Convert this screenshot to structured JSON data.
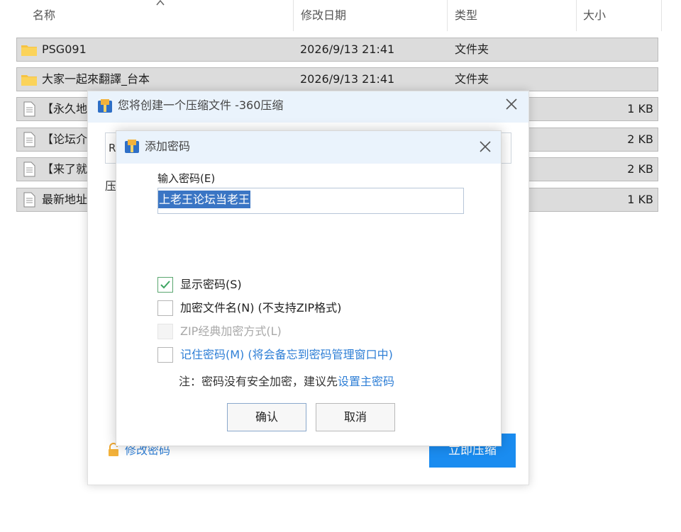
{
  "explorer": {
    "columns": {
      "name": "名称",
      "modified": "修改日期",
      "type": "类型",
      "size": "大小"
    },
    "rows": [
      {
        "name": "PSG091",
        "modified": "2026/9/13 21:41",
        "type": "文件夹",
        "size": "",
        "kind": "folder"
      },
      {
        "name": "大家一起來翻譯_台本",
        "modified": "2026/9/13 21:41",
        "type": "文件夹",
        "size": "",
        "kind": "folder"
      },
      {
        "name": "【永久地",
        "modified": "",
        "type": "",
        "size": "1 KB",
        "kind": "file"
      },
      {
        "name": "【论坛介",
        "modified": "",
        "type": "",
        "size": "2 KB",
        "kind": "file"
      },
      {
        "name": "【来了就",
        "modified": "",
        "type": "",
        "size": "2 KB",
        "kind": "file"
      },
      {
        "name": "最新地址",
        "modified": "",
        "type": "",
        "size": "1 KB",
        "kind": "file"
      }
    ]
  },
  "compress_dialog": {
    "title": "您将创建一个压缩文件 -360压缩",
    "path_prefix": "R",
    "compress_label_partial": "压",
    "modify_password": "修改密码",
    "compress_now": "立即压缩"
  },
  "password_dialog": {
    "title": "添加密码",
    "input_label": "输入密码(E)",
    "password_value": "上老王论坛当老王",
    "options": [
      {
        "label": "显示密码(S)",
        "checked": true,
        "disabled": false
      },
      {
        "label": "加密文件名(N) (不支持ZIP格式)",
        "checked": false,
        "disabled": false
      },
      {
        "label": "ZIP经典加密方式(L)",
        "checked": false,
        "disabled": true
      },
      {
        "label": "记住密码(M) (将会备忘到密码管理窗口中)",
        "checked": false,
        "disabled": false
      }
    ],
    "note_prefix": "注：密码没有安全加密，建议先",
    "note_link": "设置主密码",
    "ok": "确认",
    "cancel": "取消"
  },
  "colors": {
    "accent_blue": "#1a8cf0",
    "link_blue": "#2f7fd6",
    "selection": "#3a75c4",
    "row_bg": "#dcdcdc",
    "folder": "#f6c342",
    "title_bar": "#eaf3fc"
  }
}
